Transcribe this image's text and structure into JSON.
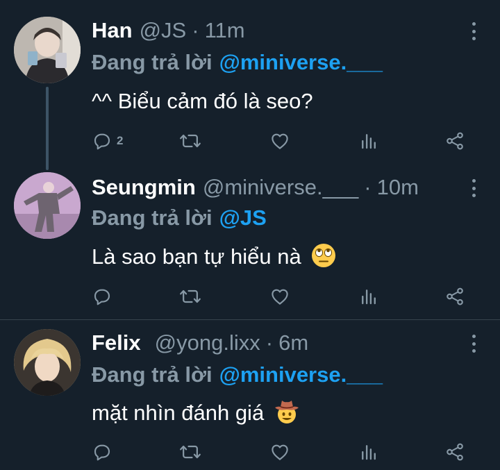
{
  "tweets": [
    {
      "name": "Han",
      "handle": "@JS",
      "dot": "·",
      "time": "11m",
      "reply_prefix": "Đang trả lời",
      "mention": "@miniverse.___",
      "text": "^^ Biểu cảm đó là seo?",
      "reply_count": "2",
      "avatar_color": "#c9c4bd"
    },
    {
      "name": "Seungmin",
      "handle": "@miniverse.___",
      "dot": "·",
      "time": "10m",
      "reply_prefix": "Đang trả lời",
      "mention": "@JS",
      "text": "Là sao bạn tự hiểu nà",
      "emoji": "face-with-rolling-eyes",
      "reply_count": "",
      "avatar_color": "#c8a7c8"
    },
    {
      "name": "Felix",
      "handle": "@yong.lixx",
      "dot": "·",
      "time": "6m",
      "reply_prefix": "Đang trả lời",
      "mention": "@miniverse.___",
      "text": "mặt nhìn đánh giá",
      "emoji": "cowboy-hat-face",
      "reply_count": "",
      "avatar_color": "#d8c6a0"
    }
  ],
  "colors": {
    "background": "#15202b",
    "secondary_text": "#8899a6",
    "accent": "#1da1f2",
    "separator": "#38444d"
  },
  "icons": [
    "reply-icon",
    "retweet-icon",
    "like-icon",
    "analytics-icon",
    "share-icon",
    "more-icon"
  ]
}
